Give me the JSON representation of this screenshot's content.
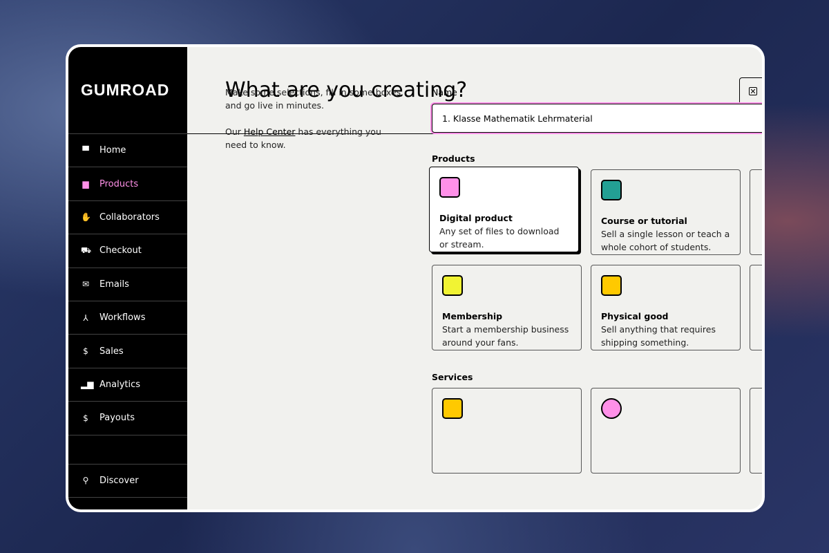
{
  "sidebar": {
    "logo": "GUMROAD",
    "items": [
      {
        "label": "Home",
        "icon": "store-icon"
      },
      {
        "label": "Products",
        "icon": "archive-icon"
      },
      {
        "label": "Collaborators",
        "icon": "handshake-icon"
      },
      {
        "label": "Checkout",
        "icon": "cart-icon"
      },
      {
        "label": "Emails",
        "icon": "envelope-icon"
      },
      {
        "label": "Workflows",
        "icon": "workflow-icon"
      },
      {
        "label": "Sales",
        "icon": "dollar-icon"
      },
      {
        "label": "Analytics",
        "icon": "bar-chart-icon"
      },
      {
        "label": "Payouts",
        "icon": "dollar-icon"
      }
    ],
    "discover": "Discover",
    "active_color": "#ff90e8"
  },
  "header": {
    "title": "What are you creating?"
  },
  "intro": {
    "line1": "Make some selections, fill in some boxes, and go live in minutes.",
    "line2_pre": "Our ",
    "link": "Help Center",
    "line2_post": " has everything you need to know."
  },
  "form": {
    "name_label": "Name",
    "name_value": "1. Klasse Mathematik Lehrmaterial",
    "products_label": "Products",
    "services_label": "Services",
    "products": [
      {
        "title": "Digital product",
        "desc": "Any set of files to download or stream.",
        "color": "#ff90e8",
        "selected": true
      },
      {
        "title": "Course or tutorial",
        "desc": "Sell a single lesson or teach a whole cohort of students.",
        "color": "#23a094"
      },
      {
        "title": "Membership",
        "desc": "Start a membership business around your fans.",
        "color": "#f1f333"
      },
      {
        "title": "Physical good",
        "desc": "Sell anything that requires shipping something.",
        "color": "#ffc900"
      }
    ],
    "services_colors": [
      "#ffc900",
      "#ff90e8"
    ]
  }
}
